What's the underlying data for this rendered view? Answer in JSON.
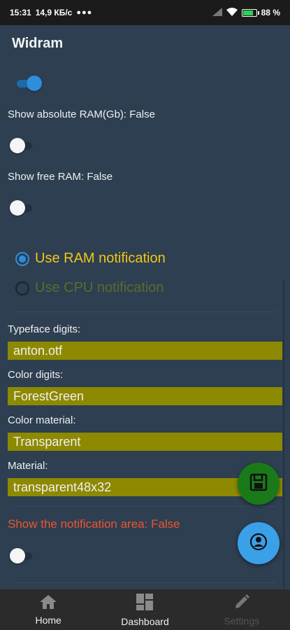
{
  "status_bar": {
    "time": "15:31",
    "speed": "14,9 КБ/с",
    "battery": "88"
  },
  "app": {
    "title": "Widram"
  },
  "settings": {
    "toggle1_on": true,
    "absolute_ram_label": "Show absolute RAM(Gb): False",
    "absolute_ram_on": false,
    "free_ram_label": "Show free RAM: False",
    "free_ram_on": false,
    "radio_ram_label": "Use RAM notification",
    "radio_cpu_label": "Use CPU notification",
    "selected_radio": "ram",
    "typeface_label": "Typeface digits:",
    "typeface_value": "anton.otf",
    "color_digits_label": "Color digits:",
    "color_digits_value": "ForestGreen",
    "color_material_label": "Color material:",
    "color_material_value": "Transparent",
    "material_label": "Material:",
    "material_value": "transparent48x32",
    "notification_area_label": "Show the notification area: False",
    "notification_area_on": false
  },
  "bottom_nav": {
    "home": "Home",
    "dashboard": "Dashboard",
    "settings": "Settings"
  },
  "colors": {
    "background": "#2d3f51",
    "accent_blue": "#2d8fdc",
    "field_olive": "#8d8900",
    "warning_orange": "#f0542d",
    "radio_active": "#f2c617",
    "save_fab": "#1a7a1a",
    "account_fab": "#3aa0e8"
  }
}
